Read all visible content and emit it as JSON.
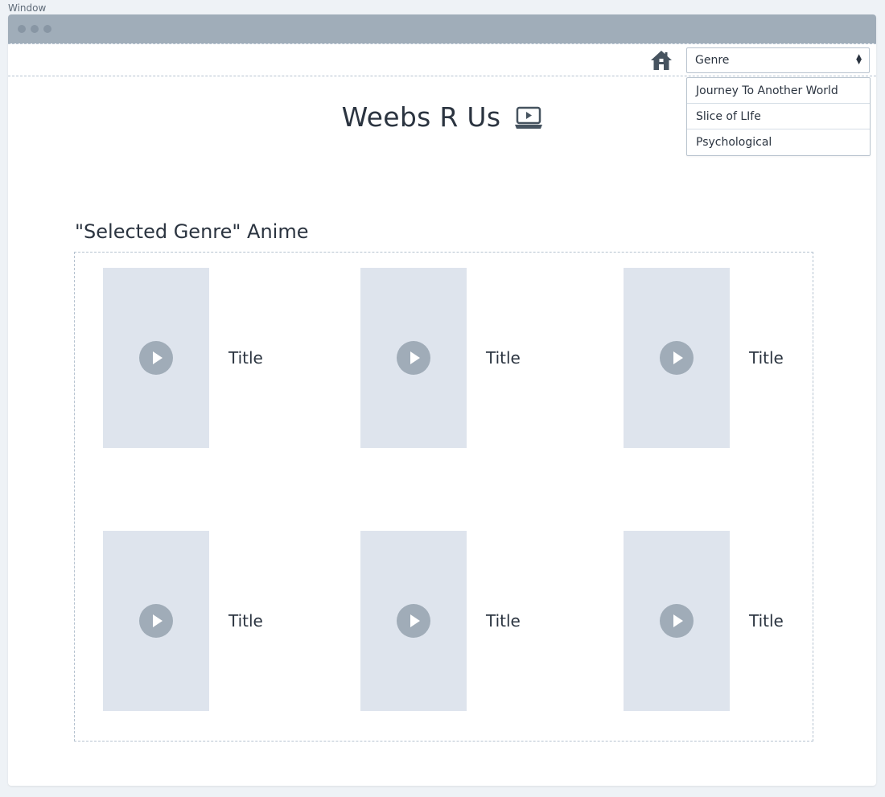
{
  "window": {
    "caption": "Window"
  },
  "nav": {
    "home_icon": "home-icon",
    "genre_select": {
      "value": "Genre",
      "options": [
        "Journey To Another World",
        "Slice of LIfe",
        "Psychological"
      ]
    }
  },
  "header": {
    "title": "Weebs R Us",
    "icon": "tv-play-icon"
  },
  "section": {
    "heading": "\"Selected Genre\" Anime"
  },
  "cards": [
    {
      "title": "Title"
    },
    {
      "title": "Title"
    },
    {
      "title": "Title"
    },
    {
      "title": "Title"
    },
    {
      "title": "Title"
    },
    {
      "title": "Title"
    }
  ],
  "colors": {
    "titlebar": "#a0adb9",
    "placeholder": "#dee4ed",
    "play_button": "#a0acb8",
    "text": "#2b3440"
  }
}
